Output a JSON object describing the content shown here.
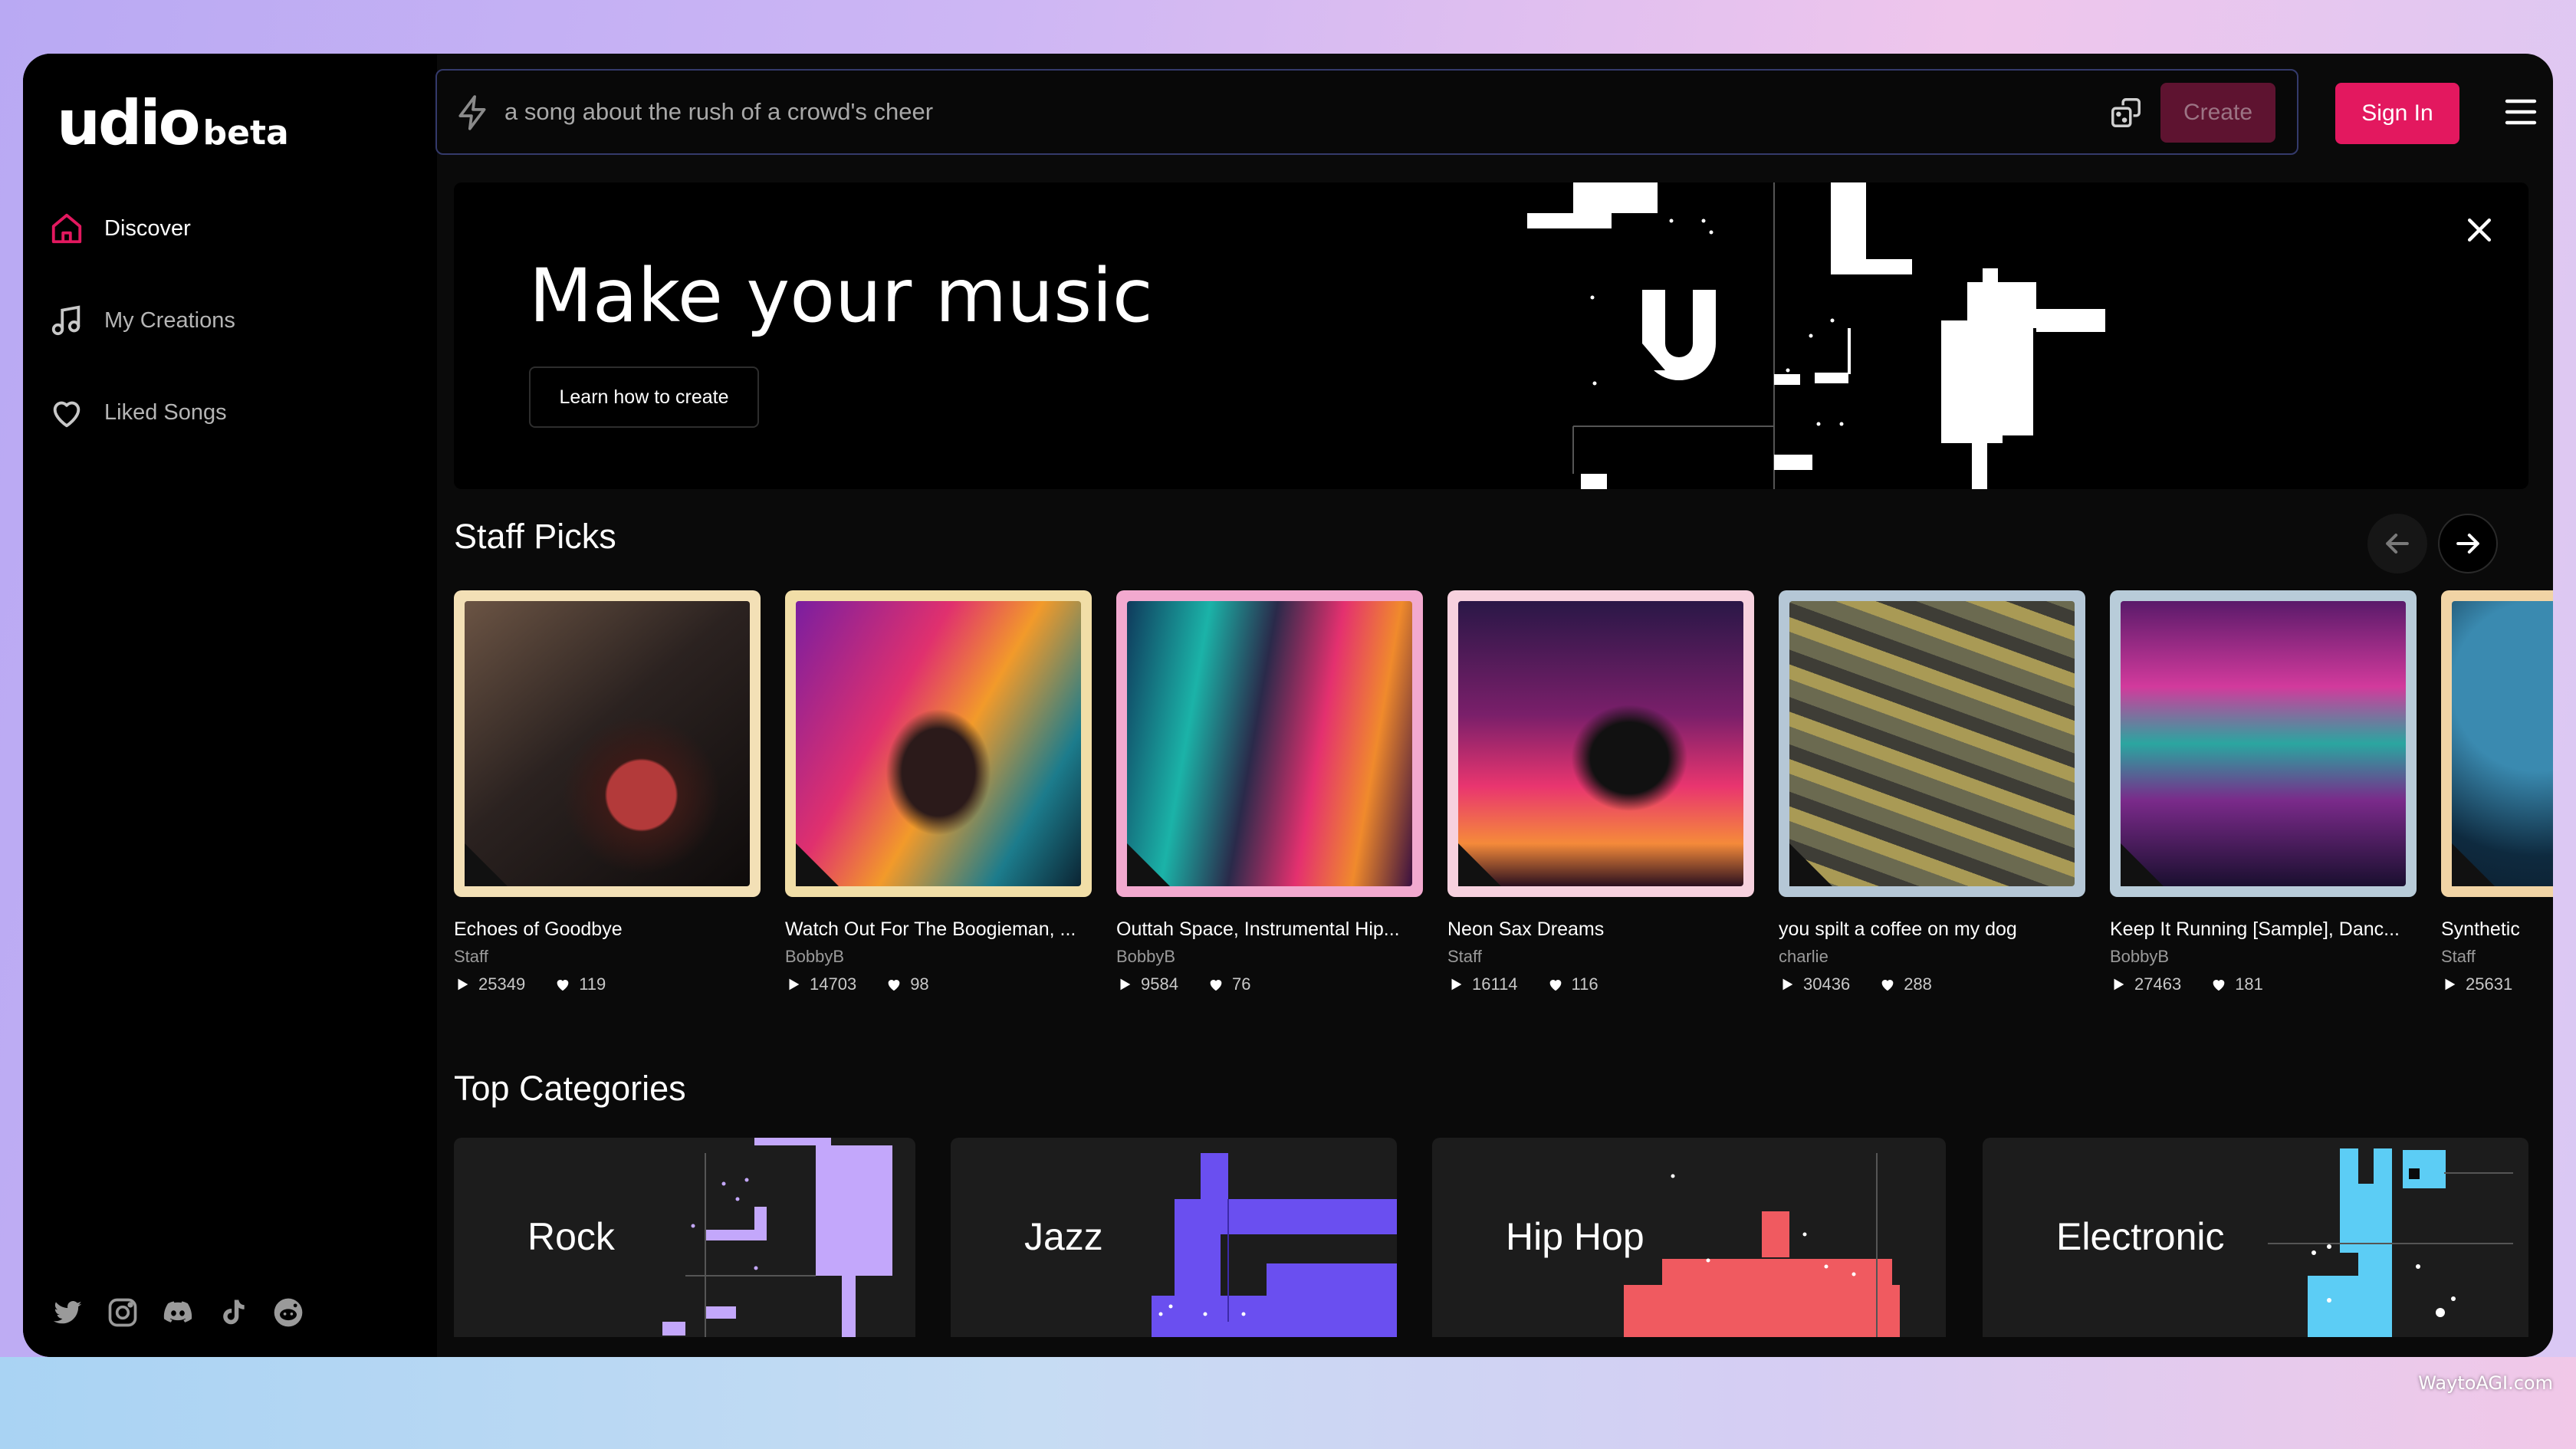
{
  "app": {
    "logo": "udio",
    "logo_badge": "beta"
  },
  "sidebar": {
    "items": [
      {
        "label": "Discover",
        "icon": "home-icon",
        "active": true
      },
      {
        "label": "My Creations",
        "icon": "music-note-icon",
        "active": false
      },
      {
        "label": "Liked Songs",
        "icon": "heart-icon",
        "active": false
      }
    ],
    "socials": [
      "twitter-icon",
      "instagram-icon",
      "discord-icon",
      "tiktok-icon",
      "reddit-icon"
    ]
  },
  "header": {
    "search_placeholder": "a song about the rush of a crowd's cheer",
    "create_label": "Create",
    "signin_label": "Sign In"
  },
  "banner": {
    "title": "Make your music",
    "button_label": "Learn how to create"
  },
  "staff_picks": {
    "title": "Staff Picks",
    "cards": [
      {
        "title": "Echoes of Goodbye",
        "author": "Staff",
        "plays": "25349",
        "likes": "119",
        "frame": "#f3e0b6"
      },
      {
        "title": "Watch Out For The Boogieman, ...",
        "author": "BobbyB",
        "plays": "14703",
        "likes": "98",
        "frame": "#f1dea7"
      },
      {
        "title": "Outtah Space, Instrumental Hip...",
        "author": "BobbyB",
        "plays": "9584",
        "likes": "76",
        "frame": "#f2a9cf"
      },
      {
        "title": "Neon Sax Dreams",
        "author": "Staff",
        "plays": "16114",
        "likes": "116",
        "frame": "#f7d1de"
      },
      {
        "title": "you spilt a coffee on my dog",
        "author": "charlie",
        "plays": "30436",
        "likes": "288",
        "frame": "#b5c7d6"
      },
      {
        "title": "Keep It Running [Sample], Danc...",
        "author": "BobbyB",
        "plays": "27463",
        "likes": "181",
        "frame": "#b8ccd9"
      },
      {
        "title": "Synthetic",
        "author": "Staff",
        "plays": "25631",
        "likes": "",
        "frame": "#f1d4a5"
      }
    ]
  },
  "top_categories": {
    "title": "Top Categories",
    "items": [
      {
        "label": "Rock",
        "color": "#c3a7fb"
      },
      {
        "label": "Jazz",
        "color": "#6a4ff0"
      },
      {
        "label": "Hip Hop",
        "color": "#f05a60"
      },
      {
        "label": "Electronic",
        "color": "#5ccdf5"
      }
    ]
  },
  "watermark": "WaytoAGI.com",
  "colors": {
    "accent": "#e3185f",
    "search_border": "#343a6b"
  }
}
